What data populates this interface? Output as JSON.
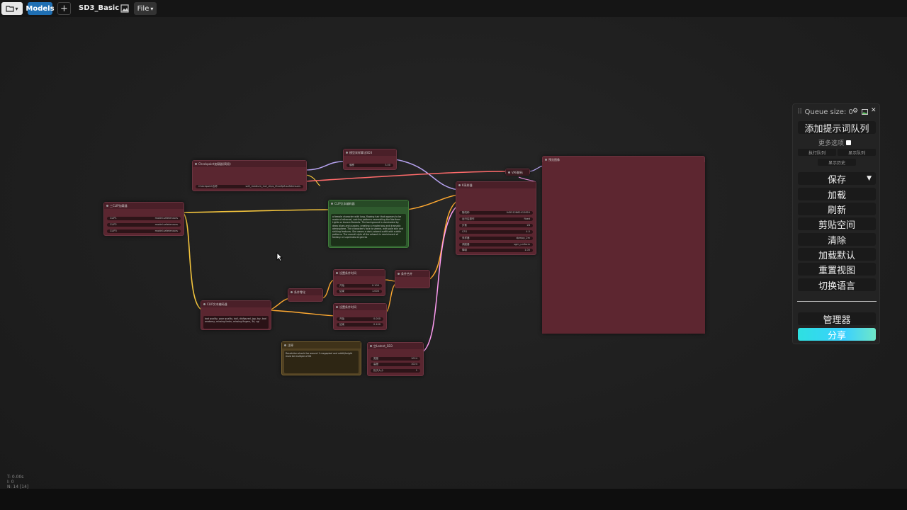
{
  "topbar": {
    "folder_icon": "folder-icon",
    "folder_caret": "▾",
    "models_label": "Models",
    "add_label": "+",
    "workflow_name": "SD3_Basic",
    "image_icon": "image-icon",
    "file_label": "File",
    "file_caret": "▾"
  },
  "nodes": {
    "checkpoint": {
      "title": "Checkpoint加载器(简易)",
      "widget_label": "Checkpoint名称",
      "widget_value": "sd3_medium_incl_clips_t5xxlfp8.safetensors"
    },
    "modelsampling": {
      "title": "模型采样算法SD3",
      "widget_label": "偏移",
      "widget_value": "3.00"
    },
    "vaedecode": {
      "title": "VAE解码"
    },
    "preview": {
      "title": "预览图像"
    },
    "triple_clip": {
      "title": "三CLIP加载器",
      "rows": [
        {
          "label": "CLIP1",
          "value": "model.safetensors"
        },
        {
          "label": "CLIP2",
          "value": "model.safetensors"
        },
        {
          "label": "CLIP3",
          "value": "model.safetensors"
        }
      ]
    },
    "positive": {
      "title": "CLIP文本编码器",
      "text": "a female character with long, flowing hair that appears to be made of ethereal, swirling patterns resembling the Northern Lights or Aurora Borealis. The background is dominated by deep blues and purples, creating a mysterious and dramatic atmosphere. The character's face is serene, with pale skin and striking features. She wears a dark-colored outfit with subtle patterns. The overall style of the artwork is reminiscent of fantasy or supernatural genres"
    },
    "ksampler": {
      "title": "K采样器",
      "rows": [
        {
          "label": "随机种",
          "value": "945512862412820"
        },
        {
          "label": "运行后操作",
          "value": "fixed"
        },
        {
          "label": "步数",
          "value": "28"
        },
        {
          "label": "CFG",
          "value": "4.5"
        },
        {
          "label": "采样器",
          "value": "dpmpp_2m"
        },
        {
          "label": "调度器",
          "value": "sgm_uniform"
        },
        {
          "label": "降噪",
          "value": "1.00"
        }
      ]
    },
    "negative": {
      "title": "CLIP文本编码器",
      "text": "bad quality, poor quality, doll, disfigured, jpg, toy, bad anatomy, missing limbs, missing fingers, 3d, cgi"
    },
    "zero_out": {
      "title": "条件零化"
    },
    "cond_range1": {
      "title": "设置条件时间",
      "rows": [
        {
          "label": "开始",
          "value": "0.100"
        },
        {
          "label": "结束",
          "value": "1.000"
        }
      ]
    },
    "cond_range2": {
      "title": "设置条件时间",
      "rows": [
        {
          "label": "开始",
          "value": "0.000"
        },
        {
          "label": "结束",
          "value": "0.100"
        }
      ]
    },
    "cond_combine": {
      "title": "条件合并"
    },
    "note": {
      "title": "注释",
      "text": "Resolution should be around 1 megapixel and width/height must be multiple of 64"
    },
    "latent": {
      "title": "空Latent_SD3",
      "rows": [
        {
          "label": "宽度",
          "value": "1024"
        },
        {
          "label": "高度",
          "value": "1024"
        },
        {
          "label": "批次大小",
          "value": "1"
        }
      ]
    }
  },
  "panel": {
    "queue_label": "Queue size: 0",
    "gear_icon": "gear-icon",
    "image_icon": "image-icon",
    "close_label": "✕",
    "queue_prompt": "添加提示词队列",
    "more_options": "更多选项",
    "view_queue": "执行队列",
    "view_history_short": "显示队列",
    "show_history": "显示历史",
    "save": "保存",
    "save_caret": "▼",
    "load": "加载",
    "refresh": "刷新",
    "clipspace": "剪贴空间",
    "clear": "清除",
    "load_default": "加载默认",
    "reset_view": "重置视图",
    "switch_language": "切换语言",
    "manager": "管理器",
    "share": "分享",
    "share_gradient": [
      "#2ee0e0",
      "#6fe7c8"
    ]
  },
  "status": {
    "line1": "T: 0.00s",
    "line2": "I: 0",
    "line3": "N: 14 [14]"
  },
  "colors": {
    "node_bg": "#5a2630",
    "positive_node": "#2f5a2e",
    "note_node": "#524223",
    "wire_clip": "#f3c43d",
    "wire_model": "#b7a3f0",
    "wire_vae": "#ff6b6b",
    "wire_latent": "#ff9cf2",
    "wire_cond": "#ffa931"
  }
}
